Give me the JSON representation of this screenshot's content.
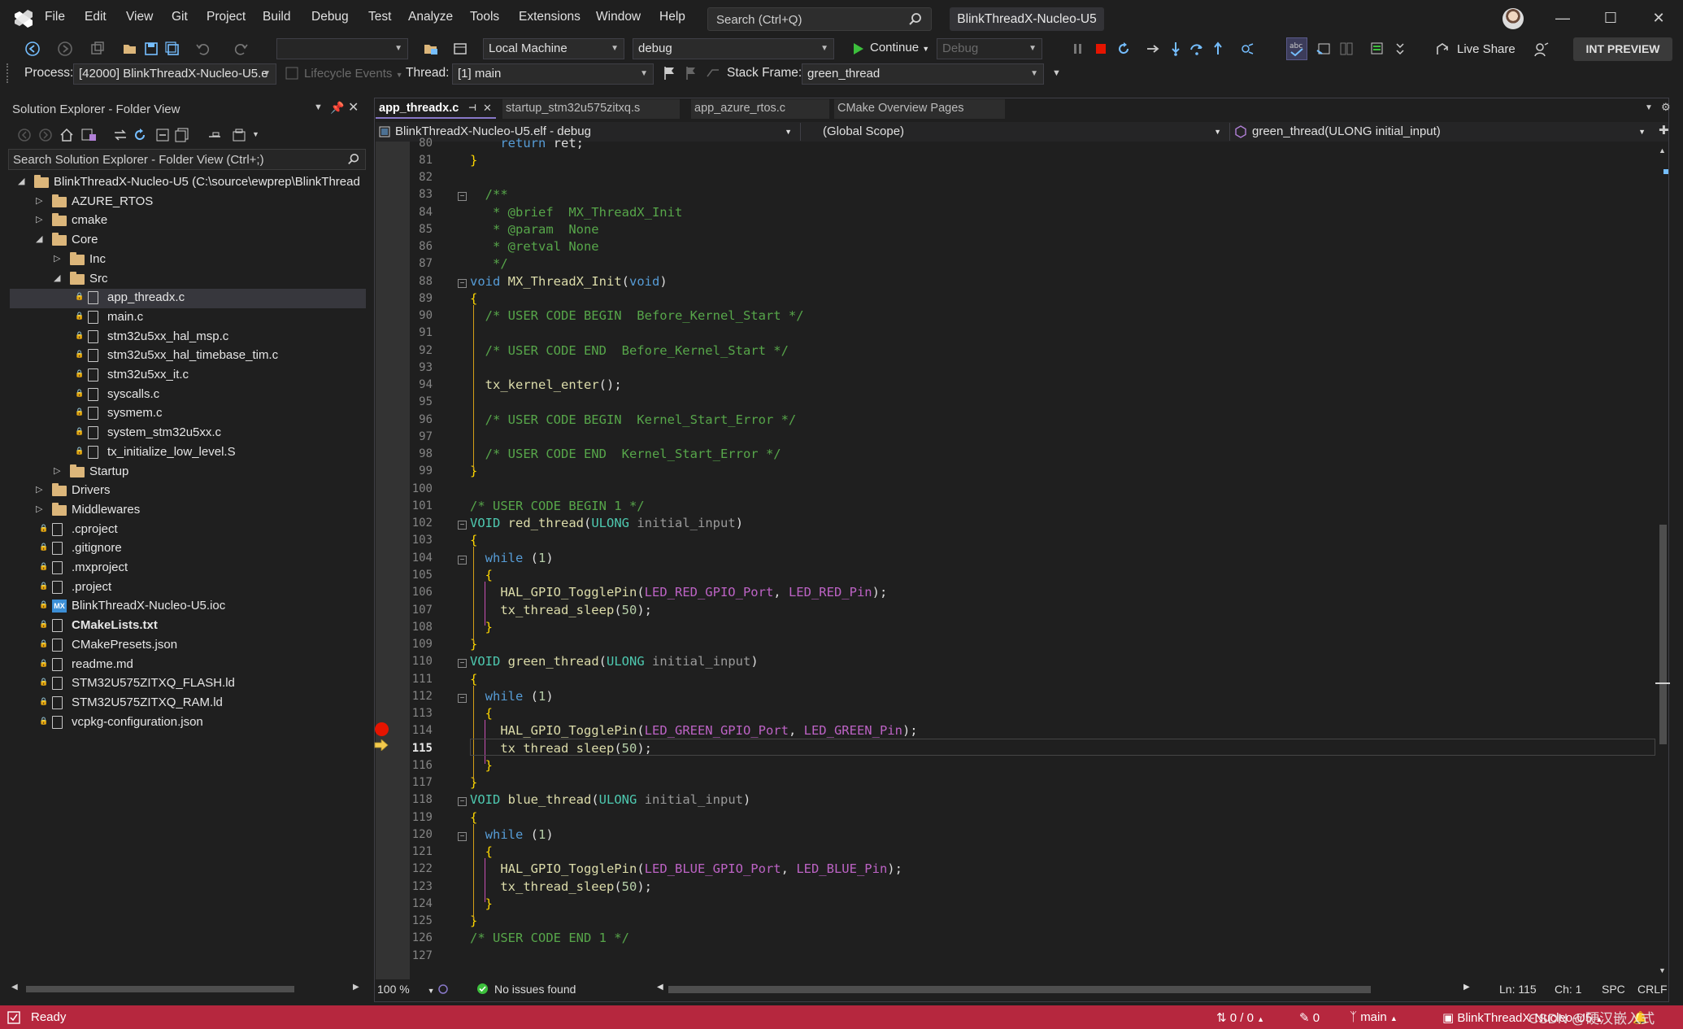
{
  "menu": {
    "items": [
      "File",
      "Edit",
      "View",
      "Git",
      "Project",
      "Build",
      "Debug",
      "Test",
      "Analyze",
      "Tools",
      "Extensions",
      "Window",
      "Help"
    ],
    "search_placeholder": "Search (Ctrl+Q)",
    "solution_title": "BlinkThreadX-Nucleo-U5"
  },
  "toolbar": {
    "target_combo": "Local Machine",
    "config_combo": "debug",
    "continue_label": "Continue",
    "debug_combo": "Debug",
    "live_share": "Live Share",
    "int_preview": "INT PREVIEW"
  },
  "debug_bar": {
    "process_label": "Process:",
    "process_value": "[42000] BlinkThreadX-Nucleo-U5.e",
    "lifecycle_label": "Lifecycle Events",
    "thread_label": "Thread:",
    "thread_value": "[1] main",
    "stack_label": "Stack Frame:",
    "stack_value": "green_thread"
  },
  "solution_explorer": {
    "title": "Solution Explorer - Folder View",
    "search_placeholder": "Search Solution Explorer - Folder View (Ctrl+;)",
    "tree": [
      {
        "label": "BlinkThreadX-Nucleo-U5 (C:\\source\\ewprep\\BlinkThread",
        "type": "folder",
        "depth": 0,
        "expand": "open"
      },
      {
        "label": "AZURE_RTOS",
        "type": "folder",
        "depth": 1,
        "expand": "closed"
      },
      {
        "label": "cmake",
        "type": "folder",
        "depth": 1,
        "expand": "closed"
      },
      {
        "label": "Core",
        "type": "folder",
        "depth": 1,
        "expand": "open"
      },
      {
        "label": "Inc",
        "type": "folder",
        "depth": 2,
        "expand": "closed"
      },
      {
        "label": "Src",
        "type": "folder",
        "depth": 2,
        "expand": "open"
      },
      {
        "label": "app_threadx.c",
        "type": "c",
        "depth": 3,
        "selected": true
      },
      {
        "label": "main.c",
        "type": "c",
        "depth": 3
      },
      {
        "label": "stm32u5xx_hal_msp.c",
        "type": "c",
        "depth": 3
      },
      {
        "label": "stm32u5xx_hal_timebase_tim.c",
        "type": "c",
        "depth": 3
      },
      {
        "label": "stm32u5xx_it.c",
        "type": "c",
        "depth": 3
      },
      {
        "label": "syscalls.c",
        "type": "c",
        "depth": 3
      },
      {
        "label": "sysmem.c",
        "type": "c",
        "depth": 3
      },
      {
        "label": "system_stm32u5xx.c",
        "type": "c",
        "depth": 3
      },
      {
        "label": "tx_initialize_low_level.S",
        "type": "file",
        "depth": 3
      },
      {
        "label": "Startup",
        "type": "folder",
        "depth": 2,
        "expand": "closed"
      },
      {
        "label": "Drivers",
        "type": "folder",
        "depth": 1,
        "expand": "closed"
      },
      {
        "label": "Middlewares",
        "type": "folder",
        "depth": 1,
        "expand": "closed"
      },
      {
        "label": ".cproject",
        "type": "file",
        "depth": 1
      },
      {
        "label": ".gitignore",
        "type": "file",
        "depth": 1
      },
      {
        "label": ".mxproject",
        "type": "file",
        "depth": 1
      },
      {
        "label": ".project",
        "type": "file",
        "depth": 1
      },
      {
        "label": "BlinkThreadX-Nucleo-U5.ioc",
        "type": "mx",
        "depth": 1
      },
      {
        "label": "CMakeLists.txt",
        "type": "file",
        "depth": 1,
        "bold": true
      },
      {
        "label": "CMakePresets.json",
        "type": "json",
        "depth": 1
      },
      {
        "label": "readme.md",
        "type": "md",
        "depth": 1
      },
      {
        "label": "STM32U575ZITXQ_FLASH.ld",
        "type": "file",
        "depth": 1
      },
      {
        "label": "STM32U575ZITXQ_RAM.ld",
        "type": "file",
        "depth": 1
      },
      {
        "label": "vcpkg-configuration.json",
        "type": "json",
        "depth": 1
      }
    ]
  },
  "tabs": [
    {
      "label": "app_threadx.c",
      "active": true
    },
    {
      "label": "startup_stm32u575zitxq.s",
      "active": false
    },
    {
      "label": "app_azure_rtos.c",
      "active": false
    },
    {
      "label": "CMake Overview Pages",
      "active": false
    }
  ],
  "navbar": {
    "project": "BlinkThreadX-Nucleo-U5.elf - debug",
    "scope": "(Global Scope)",
    "member": "green_thread(ULONG initial_input)"
  },
  "code_lines": [
    {
      "n": 80,
      "t": "    return ret;"
    },
    {
      "n": 81,
      "t": "}"
    },
    {
      "n": 82,
      "t": ""
    },
    {
      "n": 83,
      "t": "  /**"
    },
    {
      "n": 84,
      "t": "   * @brief  MX_ThreadX_Init"
    },
    {
      "n": 85,
      "t": "   * @param  None"
    },
    {
      "n": 86,
      "t": "   * @retval None"
    },
    {
      "n": 87,
      "t": "   */"
    },
    {
      "n": 88,
      "t": "void MX_ThreadX_Init(void)"
    },
    {
      "n": 89,
      "t": "{"
    },
    {
      "n": 90,
      "t": "  /* USER CODE BEGIN  Before_Kernel_Start */"
    },
    {
      "n": 91,
      "t": ""
    },
    {
      "n": 92,
      "t": "  /* USER CODE END  Before_Kernel_Start */"
    },
    {
      "n": 93,
      "t": ""
    },
    {
      "n": 94,
      "t": "  tx_kernel_enter();"
    },
    {
      "n": 95,
      "t": ""
    },
    {
      "n": 96,
      "t": "  /* USER CODE BEGIN  Kernel_Start_Error */"
    },
    {
      "n": 97,
      "t": ""
    },
    {
      "n": 98,
      "t": "  /* USER CODE END  Kernel_Start_Error */"
    },
    {
      "n": 99,
      "t": "}"
    },
    {
      "n": 100,
      "t": ""
    },
    {
      "n": 101,
      "t": "/* USER CODE BEGIN 1 */"
    },
    {
      "n": 102,
      "t": "VOID red_thread(ULONG initial_input)"
    },
    {
      "n": 103,
      "t": "{"
    },
    {
      "n": 104,
      "t": "  while (1)"
    },
    {
      "n": 105,
      "t": "  {"
    },
    {
      "n": 106,
      "t": "    HAL_GPIO_TogglePin(LED_RED_GPIO_Port, LED_RED_Pin);"
    },
    {
      "n": 107,
      "t": "    tx_thread_sleep(50);"
    },
    {
      "n": 108,
      "t": "  }"
    },
    {
      "n": 109,
      "t": "}"
    },
    {
      "n": 110,
      "t": "VOID green_thread(ULONG initial_input)"
    },
    {
      "n": 111,
      "t": "{"
    },
    {
      "n": 112,
      "t": "  while (1)"
    },
    {
      "n": 113,
      "t": "  {"
    },
    {
      "n": 114,
      "t": "    HAL_GPIO_TogglePin(LED_GREEN_GPIO_Port, LED_GREEN_Pin);"
    },
    {
      "n": 115,
      "t": "    tx_thread_sleep(50);"
    },
    {
      "n": 116,
      "t": "  }"
    },
    {
      "n": 117,
      "t": "}"
    },
    {
      "n": 118,
      "t": "VOID blue_thread(ULONG initial_input)"
    },
    {
      "n": 119,
      "t": "{"
    },
    {
      "n": 120,
      "t": "  while (1)"
    },
    {
      "n": 121,
      "t": "  {"
    },
    {
      "n": 122,
      "t": "    HAL_GPIO_TogglePin(LED_BLUE_GPIO_Port, LED_BLUE_Pin);"
    },
    {
      "n": 123,
      "t": "    tx_thread_sleep(50);"
    },
    {
      "n": 124,
      "t": "  }"
    },
    {
      "n": 125,
      "t": "}"
    },
    {
      "n": 126,
      "t": "/* USER CODE END 1 */"
    },
    {
      "n": 127,
      "t": ""
    }
  ],
  "editor_status": {
    "zoom": "100 %",
    "issues": "No issues found",
    "line": "Ln: 115",
    "col": "Ch: 1",
    "spc": "SPC",
    "eol": "CRLF"
  },
  "statusbar": {
    "ready": "Ready",
    "changes": "0 / 0",
    "pencil_count": "0",
    "branch": "main",
    "repo": "BlinkThreadX-Nucleo-U5",
    "watermark": "CSDN @硬汉嵌入式",
    "color": "#b6273e"
  },
  "colors": {
    "accent": "#8878c8",
    "breakpoint": "#e51400",
    "folder": "#dcb67a"
  }
}
